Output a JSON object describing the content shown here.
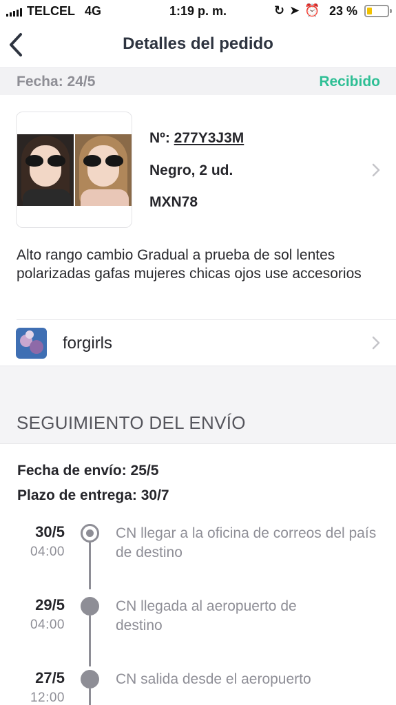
{
  "status_bar": {
    "carrier": "TELCEL",
    "network": "4G",
    "time": "1:19 p. m.",
    "battery_percent": "23 %",
    "battery_level": 0.23,
    "icons": [
      "lock-rotation-icon",
      "location-arrow-icon",
      "alarm-icon"
    ]
  },
  "nav": {
    "title": "Detalles del pedido"
  },
  "order": {
    "date": "Fecha: 24/5",
    "status": "Recibido",
    "status_color": "#2fbf95"
  },
  "product": {
    "number_prefix": "Nº: ",
    "number": "277Y3J3M",
    "variant": "Negro, 2 ud.",
    "price": "MXN78",
    "description": "Alto rango cambio Gradual a prueba de sol lentes polarizadas gafas mujeres chicas ojos use accesorios"
  },
  "shop": {
    "name": "forgirls"
  },
  "tracking": {
    "heading": "SEGUIMIENTO DEL ENVÍO",
    "ship_date": "Fecha de envío: 25/5",
    "delivery_deadline": "Plazo de entrega: 30/7",
    "events": [
      {
        "date": "30/5",
        "time": "04:00",
        "text": "CN llegar a la oficina de correos del país de destino",
        "current": true
      },
      {
        "date": "29/5",
        "time": "04:00",
        "text": "CN llegada al aeropuerto de destino",
        "current": false
      },
      {
        "date": "27/5",
        "time": "12:00",
        "text": "CN salida desde el aeropuerto",
        "current": false
      }
    ]
  }
}
